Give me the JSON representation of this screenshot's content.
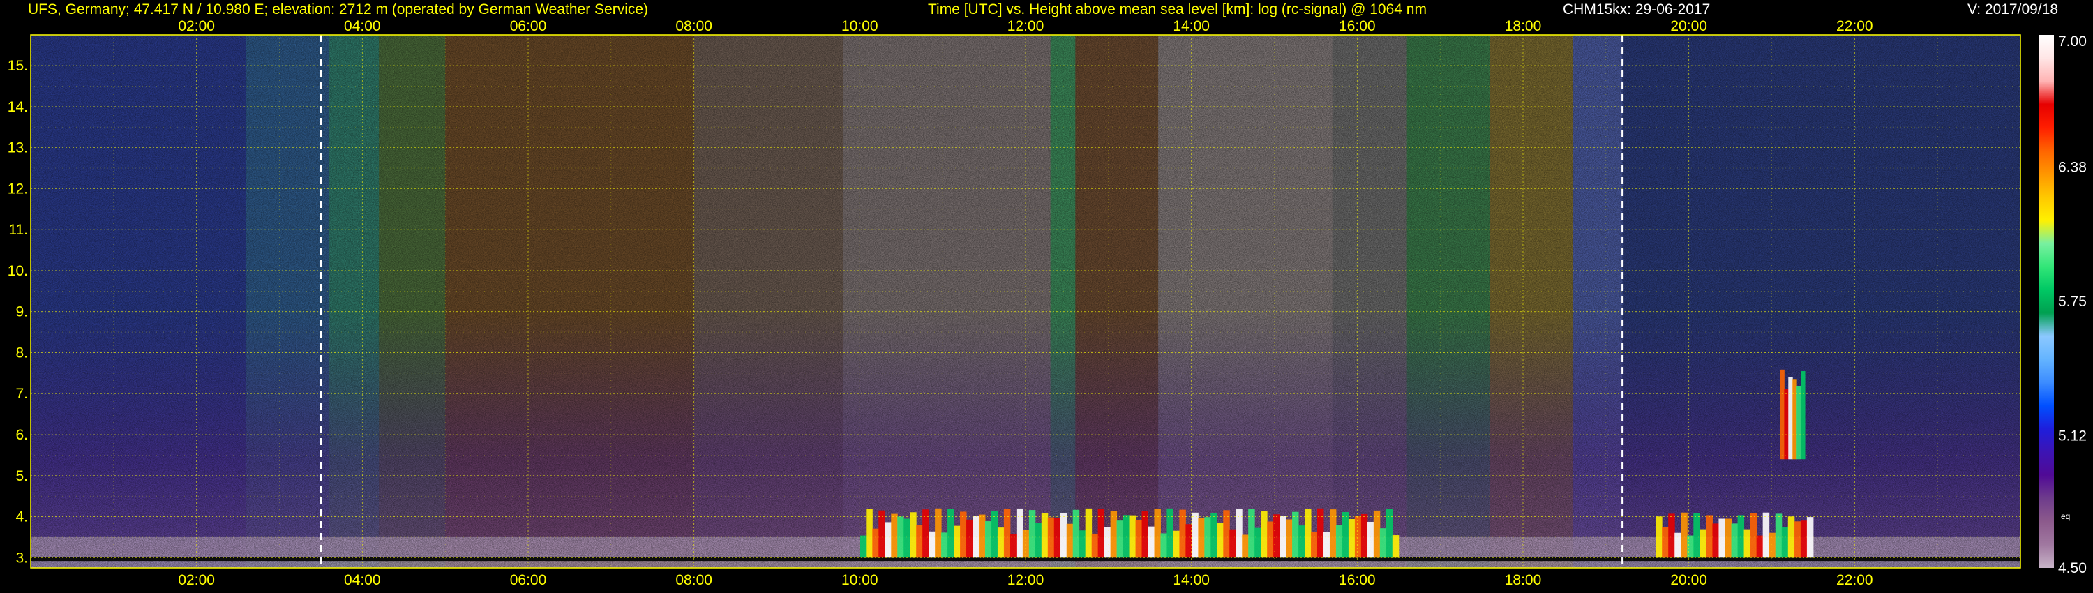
{
  "header": {
    "station": "UFS, Germany; 47.417 N / 10.980 E; elevation: 2712 m  (operated by German Weather Service)",
    "title": "Time [UTC] vs. Height above mean sea level [km]: log (rc-signal) @ 1064 nm",
    "instrument": "CHM15kx: 29-06-2017",
    "version": "V: 2017/09/18"
  },
  "chart_data": {
    "type": "heatmap",
    "title": "Time [UTC] vs. Height above mean sea level [km]: log (rc-signal) @ 1064 nm",
    "x": {
      "label": "Time [UTC]",
      "range": [
        0,
        24
      ],
      "ticks": [
        2,
        4,
        6,
        8,
        10,
        12,
        14,
        16,
        18,
        20,
        22
      ],
      "tick_labels": [
        "02:00",
        "04:00",
        "06:00",
        "08:00",
        "10:00",
        "12:00",
        "14:00",
        "16:00",
        "18:00",
        "20:00",
        "22:00"
      ]
    },
    "y": {
      "label": "Height above mean sea level [km]",
      "range": [
        2.75,
        15.75
      ],
      "ticks": [
        3,
        4,
        5,
        6,
        7,
        8,
        9,
        10,
        11,
        12,
        13,
        14,
        15
      ],
      "tick_labels": [
        "3.",
        "4.",
        "5.",
        "6.",
        "7.",
        "8.",
        "9.",
        "10.",
        "11.",
        "12.",
        "13.",
        "14.",
        "15."
      ]
    },
    "grid": true,
    "dashed_markers_utc": [
      3.5,
      19.2
    ],
    "colorbar": {
      "range": [
        4.5,
        7.0
      ],
      "tick_values": [
        7.0,
        6.38,
        5.75,
        5.12,
        4.5
      ],
      "tick_labels": [
        "7.00",
        "6.38",
        "5.75",
        "5.12",
        "4.50"
      ],
      "side_label": "eq",
      "colors": [
        "#c8b4c8",
        "#a078a0",
        "#8c5a8c",
        "#6e3c8c",
        "#500a96",
        "#3c14b4",
        "#1e1edc",
        "#0050ff",
        "#3c8cff",
        "#64b4ff",
        "#8cc8ff",
        "#00a050",
        "#00c864",
        "#32e678",
        "#78f0a0",
        "#fff000",
        "#ffc800",
        "#ff9600",
        "#ff6400",
        "#ff1e00",
        "#e60000",
        "#ffb4b4",
        "#ffe6e6",
        "#ffffff"
      ]
    },
    "cloud_layers": [
      {
        "x": [
          10.0,
          16.5
        ],
        "y": [
          3.0,
          4.2
        ]
      },
      {
        "x": [
          19.6,
          21.5
        ],
        "y": [
          3.0,
          4.1
        ]
      },
      {
        "x": [
          21.1,
          21.4
        ],
        "y": [
          5.4,
          7.7
        ]
      }
    ]
  }
}
